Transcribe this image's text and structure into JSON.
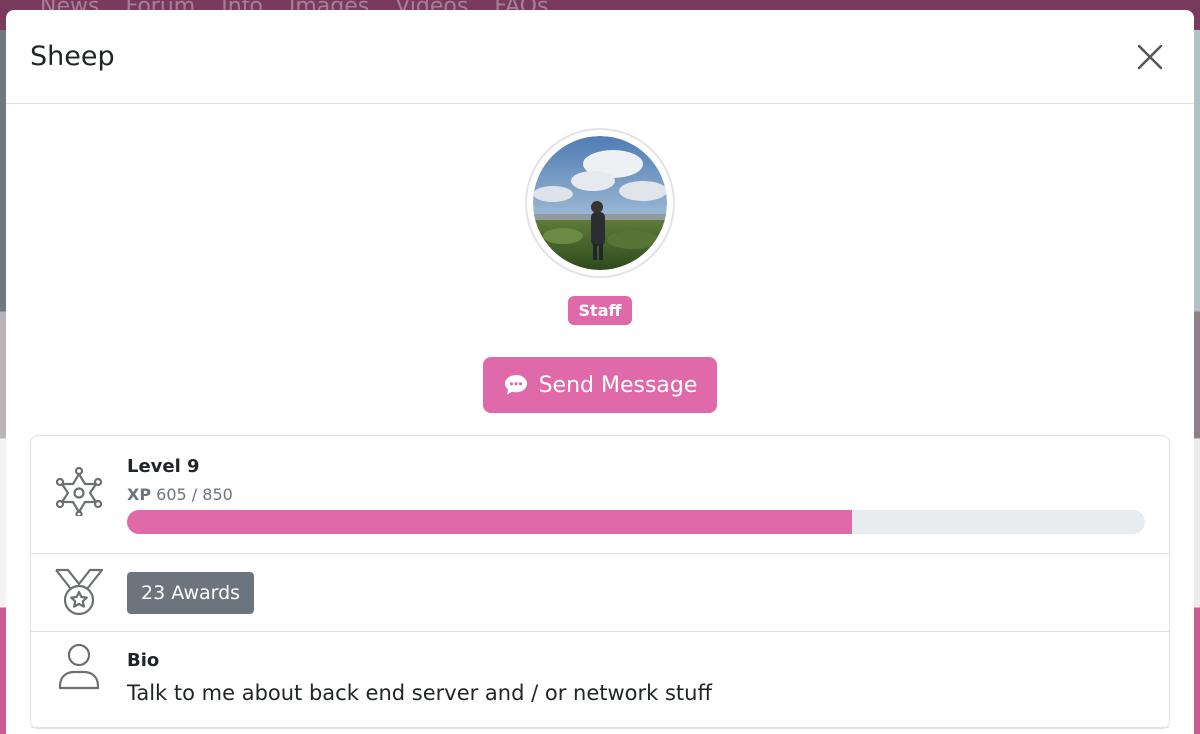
{
  "background_nav": {
    "items": [
      "News",
      "Forum",
      "Info",
      "Images",
      "Videos",
      "FAQs"
    ]
  },
  "modal": {
    "title": "Sheep",
    "close_icon": "close-icon"
  },
  "profile": {
    "avatar_icon": "avatar-photo",
    "role_badge": "Staff",
    "send_message_label": "Send Message",
    "send_message_icon": "chat-bubble-icon"
  },
  "level": {
    "icon": "sheriff-star-icon",
    "title": "Level 9",
    "xp_label": "XP",
    "xp_value": "605 / 850",
    "xp_current": 605,
    "xp_max": 850
  },
  "awards": {
    "icon": "medal-icon",
    "label": "23 Awards"
  },
  "bio": {
    "icon": "user-icon",
    "title": "Bio",
    "text": "Talk to me about back end server and / or network stuff"
  },
  "colors": {
    "accent": "#e06aa9",
    "badge_gray": "#6c757d",
    "progress_track": "#e9ecef"
  }
}
